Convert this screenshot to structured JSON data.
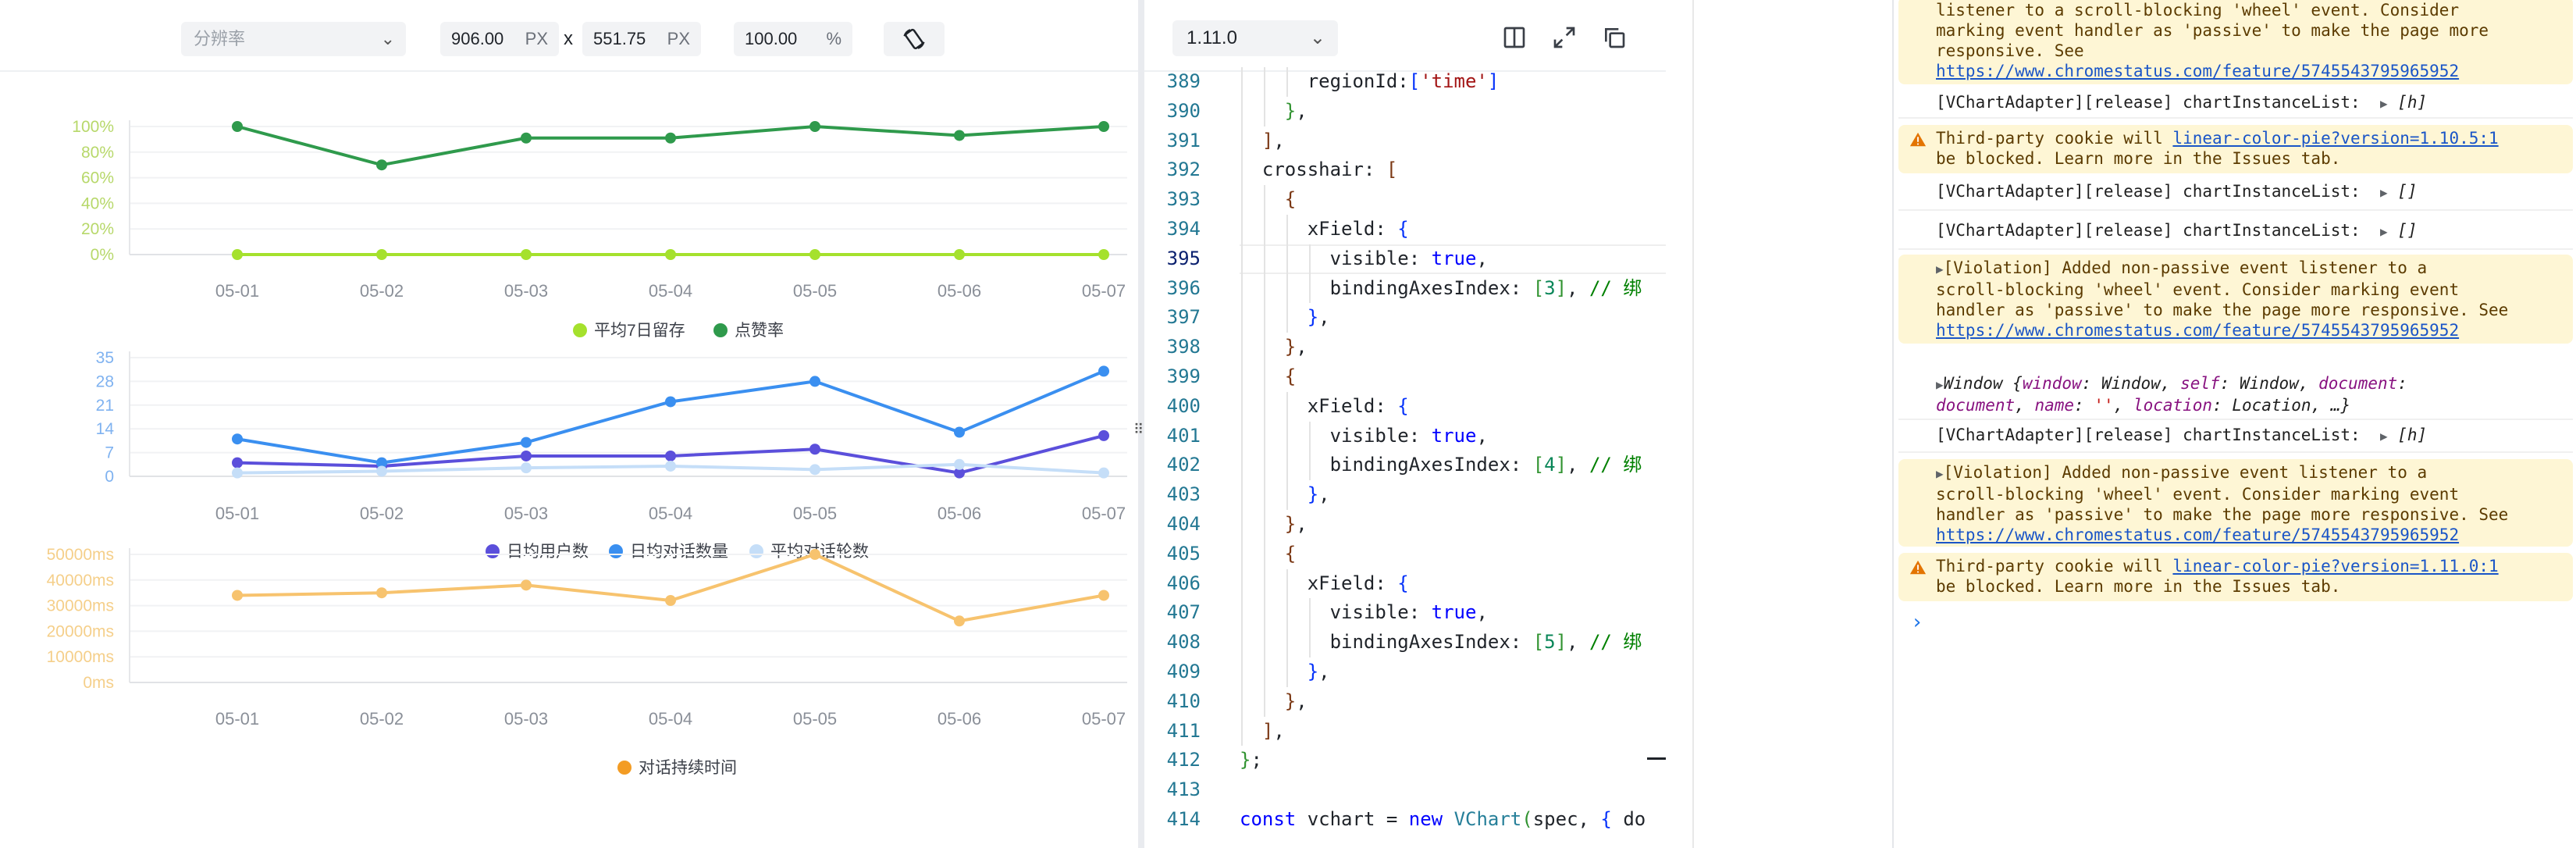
{
  "toolbar": {
    "resolution_placeholder": "分辨率",
    "width_value": "906.00",
    "width_unit": "PX",
    "times": "x",
    "height_value": "551.75",
    "height_unit": "PX",
    "zoom_value": "100.00",
    "zoom_unit": "%"
  },
  "chart_data": [
    {
      "type": "line",
      "categories": [
        "05-01",
        "05-02",
        "05-03",
        "05-04",
        "05-05",
        "05-06",
        "05-07"
      ],
      "y_ticks": [
        "100%",
        "80%",
        "60%",
        "40%",
        "20%",
        "0%"
      ],
      "ylim": [
        0,
        1.0
      ],
      "series": [
        {
          "name": "平均7日留存",
          "color": "#a5e12d",
          "values": [
            0.0,
            0.0,
            0.0,
            0.0,
            0.0,
            0.0,
            0.0
          ]
        },
        {
          "name": "点赞率",
          "color": "#2f9a4c",
          "values": [
            1.0,
            0.7,
            0.91,
            0.91,
            1.0,
            0.93,
            1.0
          ]
        }
      ],
      "legend_position": "bottom"
    },
    {
      "type": "line",
      "categories": [
        "05-01",
        "05-02",
        "05-03",
        "05-04",
        "05-05",
        "05-06",
        "05-07"
      ],
      "y_ticks": [
        "35",
        "28",
        "21",
        "14",
        "7",
        "0"
      ],
      "ylim": [
        0,
        35
      ],
      "series": [
        {
          "name": "日均用户数",
          "color": "#5b4fdb",
          "values": [
            4,
            3,
            6,
            6,
            8,
            1,
            12
          ]
        },
        {
          "name": "日均对话数量",
          "color": "#3a8ff0",
          "values": [
            11,
            4,
            10,
            22,
            28,
            13,
            31
          ]
        },
        {
          "name": "平均对话轮数",
          "color": "#c5def8",
          "values": [
            1,
            1.5,
            2.5,
            3,
            2,
            3.5,
            1
          ]
        }
      ],
      "legend_position": "bottom"
    },
    {
      "type": "line",
      "categories": [
        "05-01",
        "05-02",
        "05-03",
        "05-04",
        "05-05",
        "05-06",
        "05-07"
      ],
      "y_ticks": [
        "50000ms",
        "40000ms",
        "30000ms",
        "20000ms",
        "10000ms",
        "0ms"
      ],
      "ylim": [
        0,
        50000
      ],
      "series": [
        {
          "name": "对话持续时间",
          "color": "#f7c36e",
          "values": [
            34000,
            35000,
            38000,
            32000,
            50000,
            24000,
            34000
          ]
        }
      ],
      "legend_color": "#f39c24",
      "legend_position": "bottom"
    }
  ],
  "editor": {
    "version": "1.11.0",
    "lines": [
      {
        "n": "389",
        "indent": 6,
        "tokens": [
          [
            "",
            "regionId:"
          ],
          [
            "b1",
            "["
          ],
          [
            "str",
            "'time'"
          ],
          [
            "b1",
            "]"
          ]
        ]
      },
      {
        "n": "390",
        "indent": 4,
        "tokens": [
          [
            "b2",
            "}"
          ],
          [
            "",
            ","
          ]
        ]
      },
      {
        "n": "391",
        "indent": 2,
        "tokens": [
          [
            "b3",
            "]"
          ],
          [
            "",
            ","
          ]
        ]
      },
      {
        "n": "392",
        "indent": 2,
        "tokens": [
          [
            "",
            "crosshair: "
          ],
          [
            "b3",
            "["
          ]
        ]
      },
      {
        "n": "393",
        "indent": 4,
        "tokens": [
          [
            "b3",
            "{"
          ]
        ]
      },
      {
        "n": "394",
        "indent": 6,
        "tokens": [
          [
            "",
            "xField: "
          ],
          [
            "b1",
            "{"
          ]
        ]
      },
      {
        "n": "395",
        "indent": 8,
        "tokens": [
          [
            "",
            "visible: "
          ],
          [
            "kw",
            "true"
          ],
          [
            "",
            ","
          ]
        ]
      },
      {
        "n": "396",
        "indent": 8,
        "tokens": [
          [
            "",
            "bindingAxesIndex: "
          ],
          [
            "b2",
            "["
          ],
          [
            "num",
            "3"
          ],
          [
            "b2",
            "]"
          ],
          [
            "",
            ", "
          ],
          [
            "com",
            "// 绑"
          ]
        ]
      },
      {
        "n": "397",
        "indent": 6,
        "tokens": [
          [
            "b1",
            "}"
          ],
          [
            "",
            ","
          ]
        ]
      },
      {
        "n": "398",
        "indent": 4,
        "tokens": [
          [
            "b3",
            "}"
          ],
          [
            "",
            ","
          ]
        ]
      },
      {
        "n": "399",
        "indent": 4,
        "tokens": [
          [
            "b3",
            "{"
          ]
        ]
      },
      {
        "n": "400",
        "indent": 6,
        "tokens": [
          [
            "",
            "xField: "
          ],
          [
            "b1",
            "{"
          ]
        ]
      },
      {
        "n": "401",
        "indent": 8,
        "tokens": [
          [
            "",
            "visible: "
          ],
          [
            "kw",
            "true"
          ],
          [
            "",
            ","
          ]
        ]
      },
      {
        "n": "402",
        "indent": 8,
        "tokens": [
          [
            "",
            "bindingAxesIndex: "
          ],
          [
            "b2",
            "["
          ],
          [
            "num",
            "4"
          ],
          [
            "b2",
            "]"
          ],
          [
            "",
            ", "
          ],
          [
            "com",
            "// 绑"
          ]
        ]
      },
      {
        "n": "403",
        "indent": 6,
        "tokens": [
          [
            "b1",
            "}"
          ],
          [
            "",
            ","
          ]
        ]
      },
      {
        "n": "404",
        "indent": 4,
        "tokens": [
          [
            "b3",
            "}"
          ],
          [
            "",
            ","
          ]
        ]
      },
      {
        "n": "405",
        "indent": 4,
        "tokens": [
          [
            "b3",
            "{"
          ]
        ]
      },
      {
        "n": "406",
        "indent": 6,
        "tokens": [
          [
            "",
            "xField: "
          ],
          [
            "b1",
            "{"
          ]
        ]
      },
      {
        "n": "407",
        "indent": 8,
        "tokens": [
          [
            "",
            "visible: "
          ],
          [
            "kw",
            "true"
          ],
          [
            "",
            ","
          ]
        ]
      },
      {
        "n": "408",
        "indent": 8,
        "tokens": [
          [
            "",
            "bindingAxesIndex: "
          ],
          [
            "b2",
            "["
          ],
          [
            "num",
            "5"
          ],
          [
            "b2",
            "]"
          ],
          [
            "",
            ", "
          ],
          [
            "com",
            "// 绑"
          ]
        ]
      },
      {
        "n": "409",
        "indent": 6,
        "tokens": [
          [
            "b1",
            "}"
          ],
          [
            "",
            ","
          ]
        ]
      },
      {
        "n": "410",
        "indent": 4,
        "tokens": [
          [
            "b3",
            "}"
          ],
          [
            "",
            ","
          ]
        ]
      },
      {
        "n": "411",
        "indent": 2,
        "tokens": [
          [
            "b3",
            "]"
          ],
          [
            "",
            ","
          ]
        ]
      },
      {
        "n": "412",
        "indent": 0,
        "tokens": [
          [
            "b2",
            "}"
          ],
          [
            "",
            ";"
          ]
        ]
      },
      {
        "n": "413",
        "indent": 0,
        "tokens": []
      },
      {
        "n": "414",
        "indent": 0,
        "tokens": [
          [
            "kw",
            "const"
          ],
          [
            "",
            " vchart = "
          ],
          [
            "kw",
            "new"
          ],
          [
            "",
            " "
          ],
          [
            "cls",
            "VChart"
          ],
          [
            "b2",
            "("
          ],
          [
            "",
            "spec, "
          ],
          [
            "b1",
            "{"
          ],
          [
            "",
            " do"
          ]
        ]
      }
    ],
    "active_line": "395"
  },
  "console": {
    "m1_line1": "listener to a scroll-blocking 'wheel' event. Consider",
    "m1_line2": "marking event handler as 'passive' to make the page more",
    "m1_line3": "responsive. See",
    "m1_link": "https://www.chromestatus.com/feature/5745543795965952",
    "log_prefix": "[VChartAdapter][release] chartInstanceList:",
    "log_h": "[h]",
    "log_empty": "[]",
    "cookie_prefix": "Third-party cookie will ",
    "cookie_link_1": "linear-color-pie?version=1.10.5:1",
    "cookie_line2": "be blocked. Learn more in the Issues tab.",
    "viol_line1": "[Violation] Added non-passive event listener to a",
    "viol_line2": "scroll-blocking 'wheel' event. Consider marking event",
    "viol_line3": "handler as 'passive' to make the page more responsive. See",
    "window_obj": "Window",
    "cookie_link_2": "linear-color-pie?version=1.11.0:1"
  }
}
